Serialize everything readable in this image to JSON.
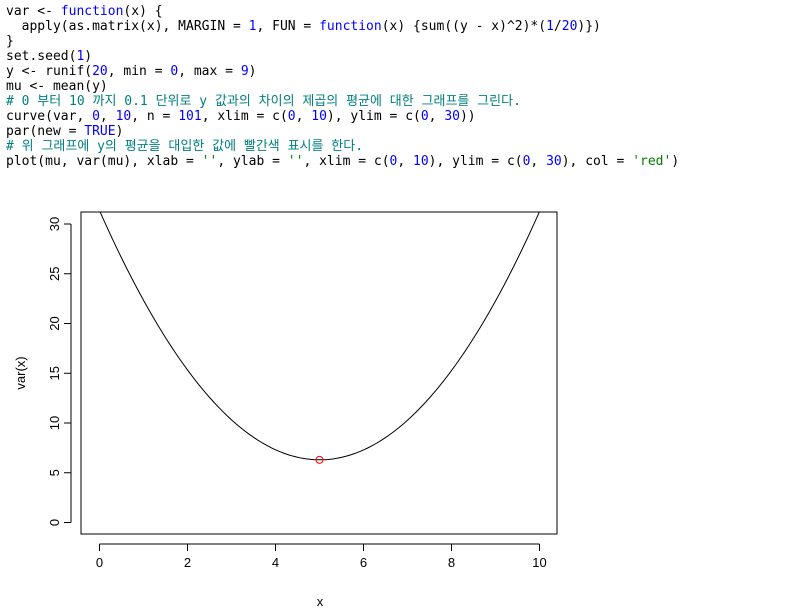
{
  "code": {
    "lines": [
      [
        [
          "var <- ",
          ""
        ],
        [
          "function",
          "kw"
        ],
        [
          "(x) {",
          ""
        ]
      ],
      [
        [
          "  apply(as.matrix(x), MARGIN = ",
          ""
        ],
        [
          "1",
          "num"
        ],
        [
          ", FUN = ",
          ""
        ],
        [
          "function",
          "kw"
        ],
        [
          "(x) {sum((y - x)^2)*(",
          ""
        ],
        [
          "1",
          "num"
        ],
        [
          "/",
          ""
        ],
        [
          "20",
          "num"
        ],
        [
          ")})",
          ""
        ]
      ],
      [
        [
          "}",
          ""
        ]
      ],
      [
        [
          "set.seed(",
          ""
        ],
        [
          "1",
          "num"
        ],
        [
          ")",
          ""
        ]
      ],
      [
        [
          "y <- runif(",
          ""
        ],
        [
          "20",
          "num"
        ],
        [
          ", min = ",
          ""
        ],
        [
          "0",
          "num"
        ],
        [
          ", max = ",
          ""
        ],
        [
          "9",
          "num"
        ],
        [
          ")",
          ""
        ]
      ],
      [
        [
          "mu <- mean(y)",
          ""
        ]
      ],
      [
        [
          "# 0 부터 10 까지 0.1 단위로 y 값과의 차이의 제곱의 평균에 대한 그래프를 그린다.",
          "cmt"
        ]
      ],
      [
        [
          "curve(var, ",
          ""
        ],
        [
          "0",
          "num"
        ],
        [
          ", ",
          ""
        ],
        [
          "10",
          "num"
        ],
        [
          ", n = ",
          ""
        ],
        [
          "101",
          "num"
        ],
        [
          ", xlim = c(",
          ""
        ],
        [
          "0",
          "num"
        ],
        [
          ", ",
          ""
        ],
        [
          "10",
          "num"
        ],
        [
          "), ylim = c(",
          ""
        ],
        [
          "0",
          "num"
        ],
        [
          ", ",
          ""
        ],
        [
          "30",
          "num"
        ],
        [
          "))",
          ""
        ]
      ],
      [
        [
          "par(new = ",
          ""
        ],
        [
          "TRUE",
          "kw"
        ],
        [
          ")",
          ""
        ]
      ],
      [
        [
          "# 위 그래프에 y의 평균을 대입한 값에 빨간색 표시를 한다.",
          "cmt"
        ]
      ],
      [
        [
          "plot(mu, var(mu), xlab = ",
          ""
        ],
        [
          "''",
          "str"
        ],
        [
          ", ylab = ",
          ""
        ],
        [
          "''",
          "str"
        ],
        [
          ", xlim = c(",
          ""
        ],
        [
          "0",
          "num"
        ],
        [
          ", ",
          ""
        ],
        [
          "10",
          "num"
        ],
        [
          "), ylim = c(",
          ""
        ],
        [
          "0",
          "num"
        ],
        [
          ", ",
          ""
        ],
        [
          "30",
          "num"
        ],
        [
          "), col = ",
          ""
        ],
        [
          "'red'",
          "str"
        ],
        [
          ")",
          ""
        ]
      ]
    ]
  },
  "chart_data": {
    "type": "line",
    "xlabel": "x",
    "ylabel": "var(x)",
    "xlim": [
      0,
      10
    ],
    "ylim": [
      0,
      30
    ],
    "x_ticks": [
      0,
      2,
      4,
      6,
      8,
      10
    ],
    "y_ticks": [
      0,
      5,
      10,
      15,
      20,
      25,
      30
    ],
    "curve": {
      "formula": "(x - 5.005)^2 + 6.3",
      "n": 101
    },
    "point": {
      "x": 5.0,
      "y": 6.3,
      "color": "#ff0000"
    },
    "line_color": "#000000"
  }
}
